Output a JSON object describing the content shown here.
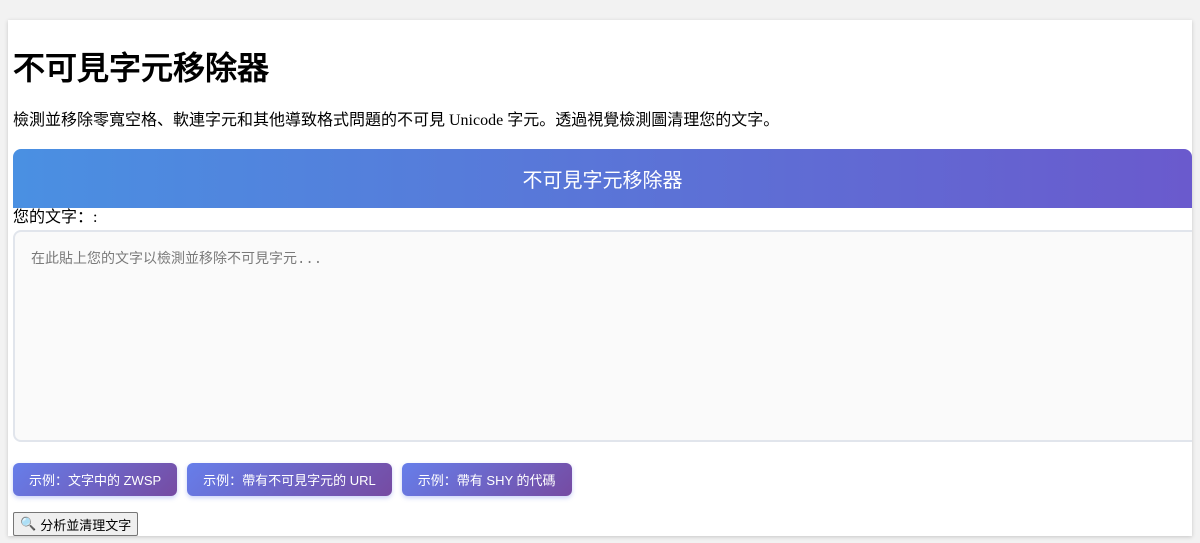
{
  "page": {
    "title": "不可見字元移除器",
    "description": "檢測並移除零寬空格、軟連字元和其他導致格式問題的不可見 Unicode 字元。透過視覺檢測圖清理您的文字。"
  },
  "tool": {
    "header_title": "不可見字元移除器",
    "text_label": "您的文字：:",
    "text_placeholder": "在此貼上您的文字以檢測並移除不可見字元...",
    "text_value": ""
  },
  "examples": [
    {
      "label": "示例：文字中的 ZWSP"
    },
    {
      "label": "示例：帶有不可見字元的 URL"
    },
    {
      "label": "示例：帶有 SHY 的代碼"
    }
  ],
  "actions": {
    "analyze_icon": "magnifier-icon",
    "analyze_label": "分析並清理文字"
  },
  "colors": {
    "header_gradient_start": "#4a90e2",
    "header_gradient_end": "#6a5acd",
    "button_gradient_start": "#667eea",
    "button_gradient_end": "#764ba2"
  }
}
